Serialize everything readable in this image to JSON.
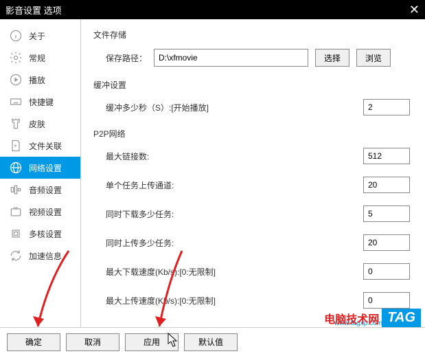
{
  "titlebar": {
    "title": "影音设置 选项"
  },
  "sidebar": {
    "items": [
      {
        "label": "关于"
      },
      {
        "label": "常规"
      },
      {
        "label": "播放"
      },
      {
        "label": "快捷键"
      },
      {
        "label": "皮肤"
      },
      {
        "label": "文件关联"
      },
      {
        "label": "网络设置"
      },
      {
        "label": "音频设置"
      },
      {
        "label": "视频设置"
      },
      {
        "label": "多核设置"
      },
      {
        "label": "加速信息"
      }
    ]
  },
  "sections": {
    "file_storage": {
      "title": "文件存储",
      "path_label": "保存路径：",
      "path_value": "D:\\xfmovie",
      "select_btn": "选择",
      "browse_btn": "浏览"
    },
    "buffer": {
      "title": "缓冲设置",
      "label": "缓冲多少秒（S）:[开始播放]",
      "value": "2"
    },
    "p2p": {
      "title": "P2P网络",
      "max_conn_label": "最大链接数:",
      "max_conn_value": "512",
      "upload_ch_label": "单个任务上传通道:",
      "upload_ch_value": "20",
      "dl_tasks_label": "同时下载多少任务:",
      "dl_tasks_value": "5",
      "ul_tasks_label": "同时上传多少任务:",
      "ul_tasks_value": "20",
      "max_dl_label": "最大下载速度(Kb/s):[0:无限制]",
      "max_dl_value": "0",
      "max_ul_label": "最大上传速度(Kb/s):[0:无限制]",
      "max_ul_value": "0"
    }
  },
  "footer": {
    "ok": "确定",
    "cancel": "取消",
    "apply": "应用",
    "default": "默认值"
  },
  "watermark": {
    "text": "电脑技术网",
    "tag": "TAG",
    "url": "www.tagxp.com"
  }
}
